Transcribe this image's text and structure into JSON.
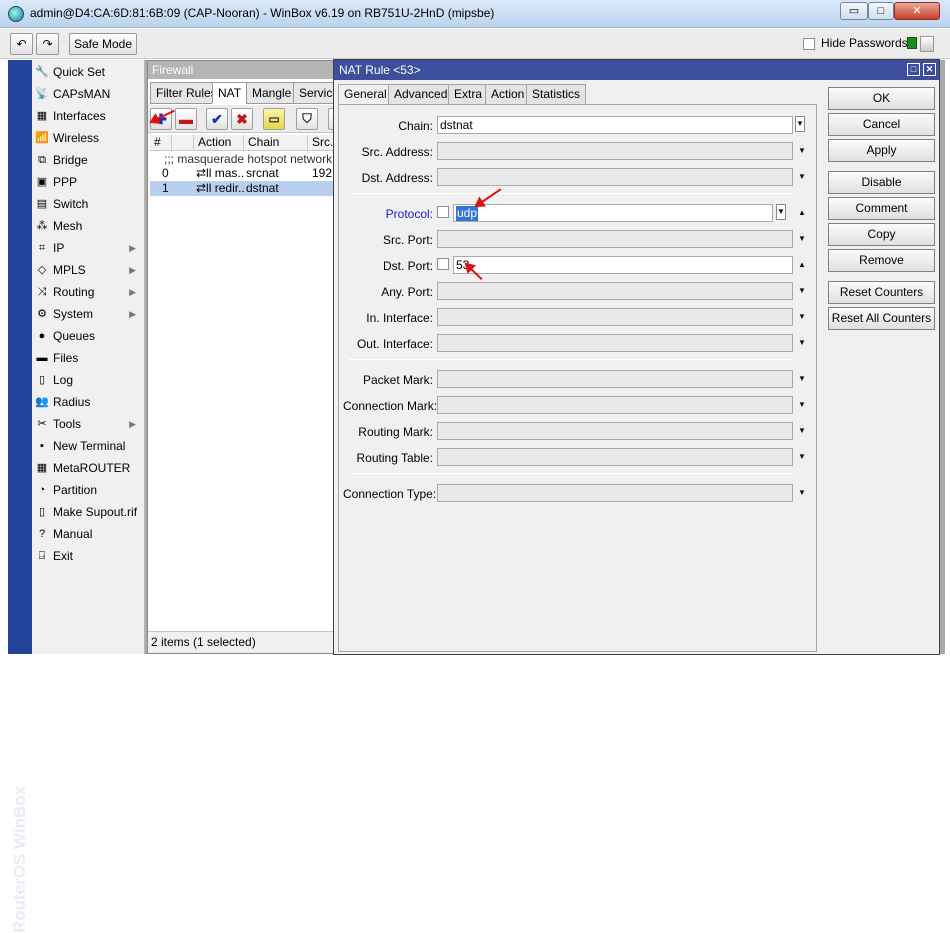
{
  "window": {
    "title": "admin@D4:CA:6D:81:6B:09 (CAP-Nooran) - WinBox v6.19 on RB751U-2HnD (mipsbe)",
    "minimize": "▭",
    "maximize": "□",
    "close": "✕"
  },
  "toolbar": {
    "undo": "↶",
    "redo": "↷",
    "safe_mode": "Safe Mode",
    "hide_passwords": "Hide Passwords"
  },
  "brand": "RouterOS WinBox",
  "sidebar": [
    {
      "label": "Quick Set",
      "icon": "quick-set-icon",
      "glyph": "🔧",
      "submenu": false
    },
    {
      "label": "CAPsMAN",
      "icon": "capsman-icon",
      "glyph": "📡",
      "submenu": false
    },
    {
      "label": "Interfaces",
      "icon": "interfaces-icon",
      "glyph": "▦",
      "submenu": false
    },
    {
      "label": "Wireless",
      "icon": "wireless-icon",
      "glyph": "📶",
      "submenu": false
    },
    {
      "label": "Bridge",
      "icon": "bridge-icon",
      "glyph": "⧉",
      "submenu": false
    },
    {
      "label": "PPP",
      "icon": "ppp-icon",
      "glyph": "▣",
      "submenu": false
    },
    {
      "label": "Switch",
      "icon": "switch-icon",
      "glyph": "▤",
      "submenu": false
    },
    {
      "label": "Mesh",
      "icon": "mesh-icon",
      "glyph": "⁂",
      "submenu": false
    },
    {
      "label": "IP",
      "icon": "ip-icon",
      "glyph": "⌗",
      "submenu": true
    },
    {
      "label": "MPLS",
      "icon": "mpls-icon",
      "glyph": "◇",
      "submenu": true
    },
    {
      "label": "Routing",
      "icon": "routing-icon",
      "glyph": "⤨",
      "submenu": true
    },
    {
      "label": "System",
      "icon": "system-icon",
      "glyph": "⚙",
      "submenu": true
    },
    {
      "label": "Queues",
      "icon": "queues-icon",
      "glyph": "●",
      "submenu": false
    },
    {
      "label": "Files",
      "icon": "files-icon",
      "glyph": "▬",
      "submenu": false
    },
    {
      "label": "Log",
      "icon": "log-icon",
      "glyph": "▯",
      "submenu": false
    },
    {
      "label": "Radius",
      "icon": "radius-icon",
      "glyph": "👥",
      "submenu": false
    },
    {
      "label": "Tools",
      "icon": "tools-icon",
      "glyph": "✂",
      "submenu": true
    },
    {
      "label": "New Terminal",
      "icon": "terminal-icon",
      "glyph": "▪",
      "submenu": false
    },
    {
      "label": "MetaROUTER",
      "icon": "metarouter-icon",
      "glyph": "▦",
      "submenu": false
    },
    {
      "label": "Partition",
      "icon": "partition-icon",
      "glyph": "◔",
      "submenu": false
    },
    {
      "label": "Make Supout.rif",
      "icon": "supout-icon",
      "glyph": "▯",
      "submenu": false
    },
    {
      "label": "Manual",
      "icon": "manual-icon",
      "glyph": "?",
      "submenu": false
    },
    {
      "label": "Exit",
      "icon": "exit-icon",
      "glyph": "⍈",
      "submenu": false
    }
  ],
  "firewall": {
    "title": "Firewall",
    "tabs": [
      "Filter Rules",
      "NAT",
      "Mangle",
      "Service"
    ],
    "active_tab": "NAT",
    "columns": [
      "#",
      "Action",
      "Chain",
      "Src."
    ],
    "comment_row": ";;; masquerade hotspot network",
    "rows": [
      {
        "num": "0",
        "action": "⇄ll mas...",
        "chain": "srcnat",
        "src": "192."
      },
      {
        "num": "1",
        "action": "⇄ll redir...",
        "chain": "dstnat",
        "src": ""
      }
    ],
    "status": "2 items (1 selected)"
  },
  "nat_rule": {
    "title": "NAT Rule <53>",
    "tabs": [
      "General",
      "Advanced",
      "Extra",
      "Action",
      "Statistics"
    ],
    "fields": {
      "chain": {
        "label": "Chain:",
        "value": "dstnat"
      },
      "src_address": {
        "label": "Src. Address:",
        "value": ""
      },
      "dst_address": {
        "label": "Dst. Address:",
        "value": ""
      },
      "protocol": {
        "label": "Protocol:",
        "value": "udp"
      },
      "src_port": {
        "label": "Src. Port:",
        "value": ""
      },
      "dst_port": {
        "label": "Dst. Port:",
        "value": "53"
      },
      "any_port": {
        "label": "Any. Port:",
        "value": ""
      },
      "in_interface": {
        "label": "In. Interface:",
        "value": ""
      },
      "out_interface": {
        "label": "Out. Interface:",
        "value": ""
      },
      "packet_mark": {
        "label": "Packet Mark:",
        "value": ""
      },
      "connection_mark": {
        "label": "Connection Mark:",
        "value": ""
      },
      "routing_mark": {
        "label": "Routing Mark:",
        "value": ""
      },
      "routing_table": {
        "label": "Routing Table:",
        "value": ""
      },
      "connection_type": {
        "label": "Connection Type:",
        "value": ""
      }
    },
    "buttons": [
      "OK",
      "Cancel",
      "Apply",
      "Disable",
      "Comment",
      "Copy",
      "Remove",
      "Reset Counters",
      "Reset All Counters"
    ]
  },
  "colors": {
    "accent": "#3c4e9c",
    "brand_strip": "#23439a",
    "selection": "#b9cff0",
    "annotation_arrow": "#e01010",
    "link_label": "#1a1ac8"
  }
}
